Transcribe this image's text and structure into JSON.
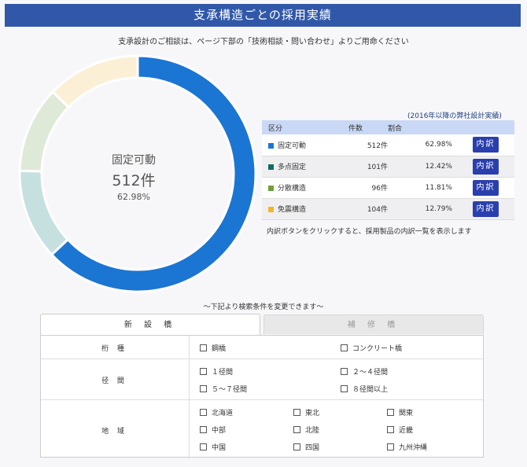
{
  "title": "支承構造ごとの採用実績",
  "subtitle": "支承設計のご相談は、ページ下部の「技術相談・問い合わせ」よりご用命ください",
  "chart_data": {
    "type": "pie",
    "categories": [
      "固定可動",
      "多点固定",
      "分散構造",
      "免震構造"
    ],
    "values": [
      512,
      101,
      96,
      104
    ],
    "percents": [
      62.98,
      12.42,
      11.81,
      12.79
    ],
    "colors": [
      "#1b75d3",
      "#c6e0e0",
      "#dfe9d7",
      "#fbf0d6"
    ],
    "center": {
      "label": "固定可動",
      "value": "512件",
      "pct": "62.98%"
    }
  },
  "table": {
    "note": "(2016年以降の弊社設計実績)",
    "headers": [
      "区分",
      "件数",
      "割合"
    ],
    "rows": [
      {
        "category": "固定可動",
        "count": "512件",
        "ratio": "62.98%",
        "swatch": "#1b75d3",
        "button": "内訳"
      },
      {
        "category": "多点固定",
        "count": "101件",
        "ratio": "12.42%",
        "swatch": "#0e6d5d",
        "button": "内訳"
      },
      {
        "category": "分散構造",
        "count": "96件",
        "ratio": "11.81%",
        "swatch": "#6ea13a",
        "button": "内訳"
      },
      {
        "category": "免震構造",
        "count": "104件",
        "ratio": "12.79%",
        "swatch": "#f3b629",
        "button": "内訳"
      }
    ],
    "caption": "内訳ボタンをクリックすると、採用製品の内訳一覧を表示します"
  },
  "search": {
    "note": "～下記より検索条件を変更できます～",
    "tabs": [
      "新 設 橋",
      "補 修 橋"
    ],
    "rows": [
      {
        "label": "桁 種",
        "options": [
          "鋼橋",
          "コンクリート橋"
        ]
      },
      {
        "label": "径 間",
        "options": [
          "１径間",
          "２～４径間",
          "５～７径間",
          "８径間以上"
        ]
      },
      {
        "label": "地 域",
        "options": [
          "北海道",
          "東北",
          "関東",
          "中部",
          "北陸",
          "近畿",
          "中国",
          "四国",
          "九州沖縄"
        ]
      }
    ]
  }
}
